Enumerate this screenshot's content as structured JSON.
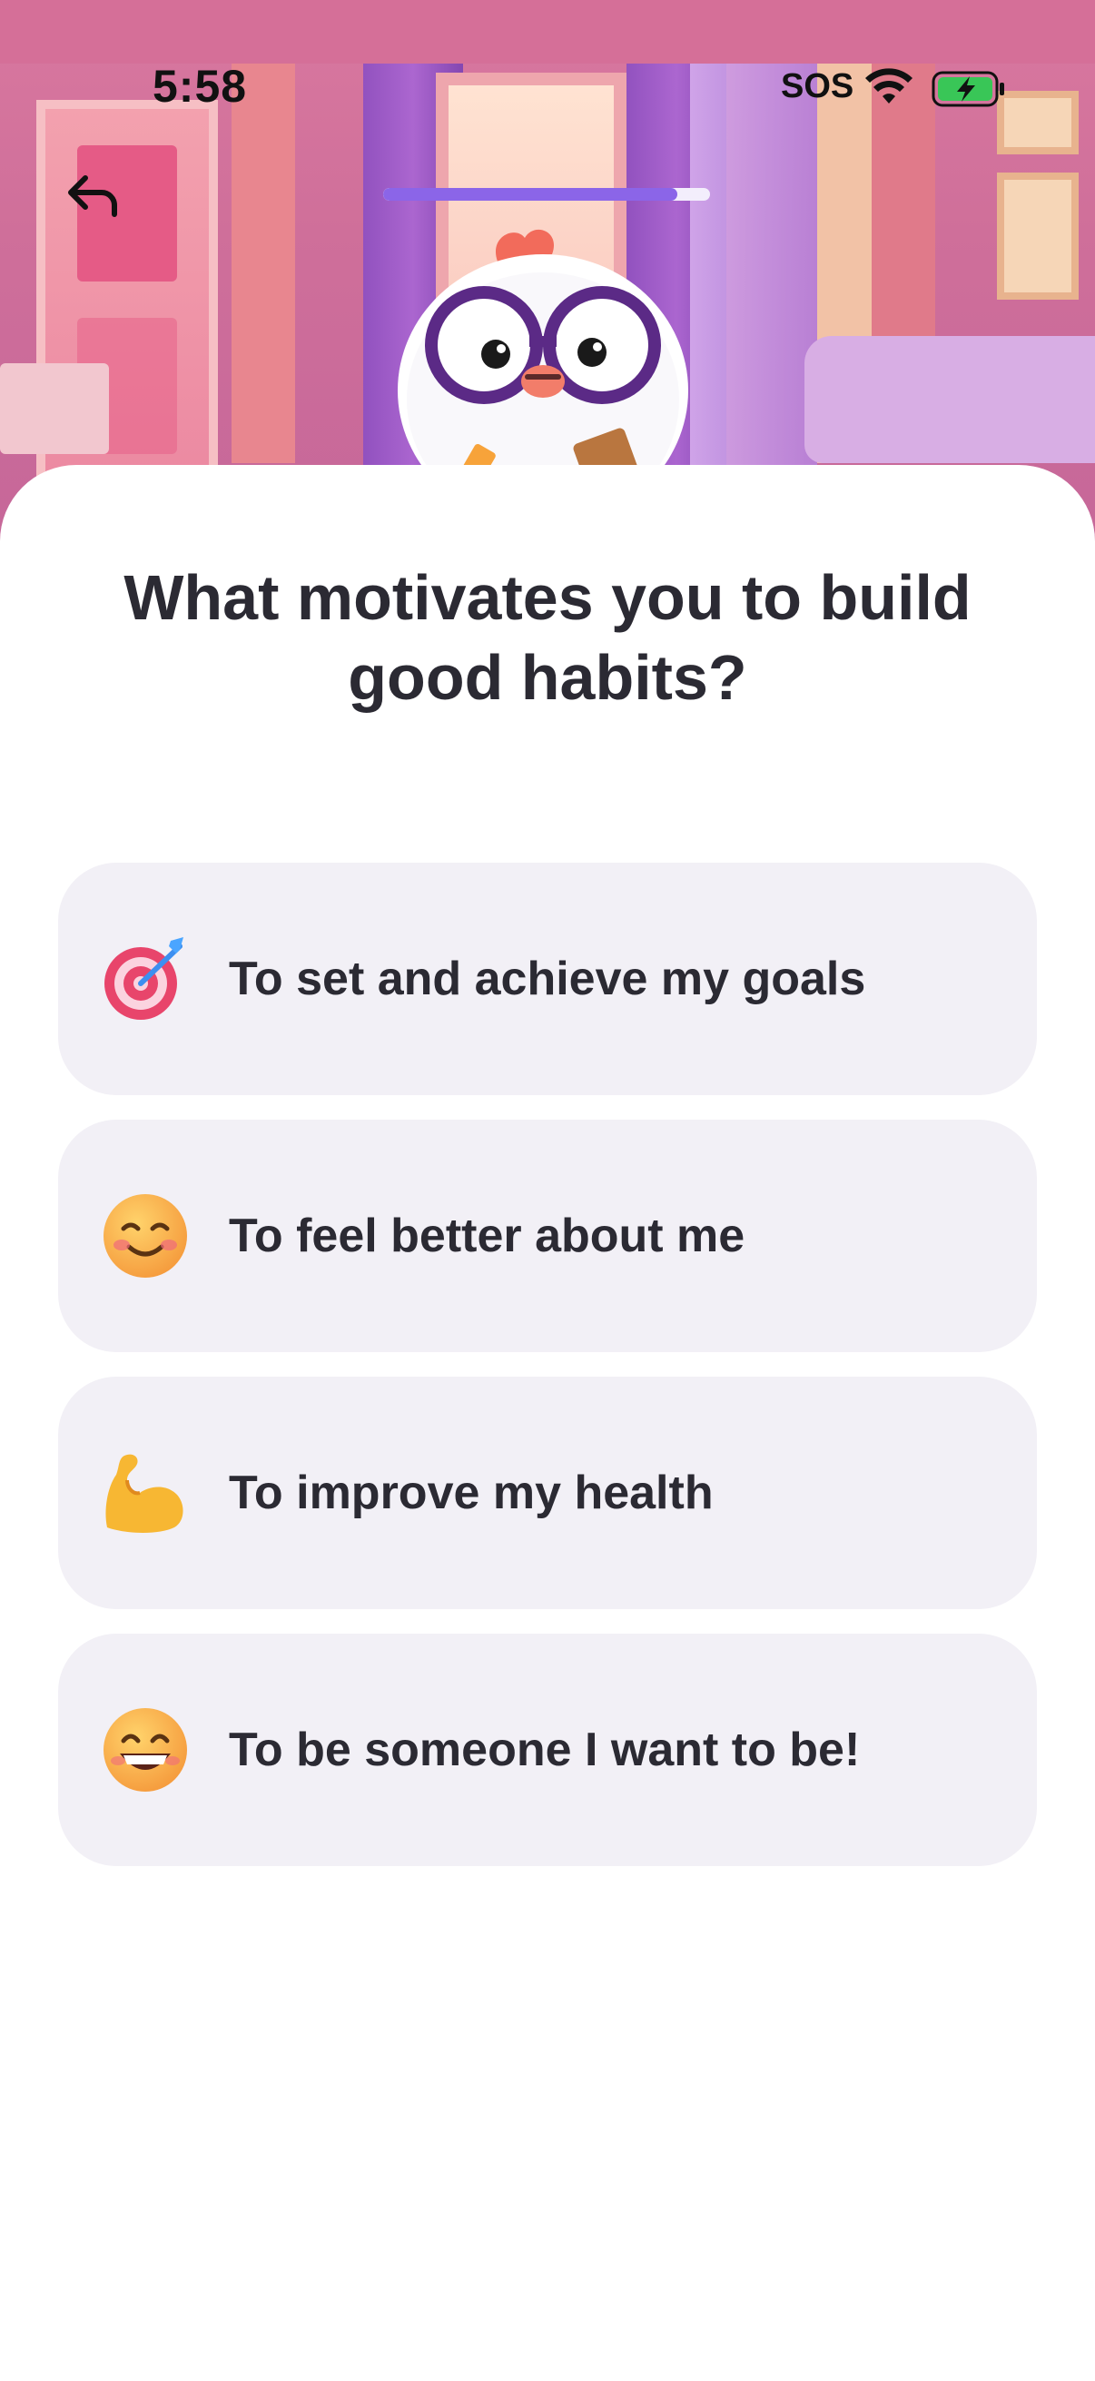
{
  "status_bar": {
    "time": "5:58",
    "carrier_text": "SOS",
    "wifi_icon": "wifi-icon",
    "battery_icon": "battery-charging-icon"
  },
  "nav": {
    "back_icon": "back-arrow-icon",
    "progress_fraction": 0.9
  },
  "mascot": {
    "icon": "chicken-with-glasses-mascot"
  },
  "question": {
    "text": "What motivates you to build good habits?"
  },
  "options": [
    {
      "icon": "target-dart-emoji",
      "label": "To set and achieve my goals"
    },
    {
      "icon": "smiling-face-emoji",
      "label": "To feel better about me"
    },
    {
      "icon": "flexed-biceps-emoji",
      "label": "To improve my health"
    },
    {
      "icon": "grinning-face-emoji",
      "label": "To be someone I want to be!"
    }
  ],
  "colors": {
    "accent": "#8b65e8",
    "option_background": "#f2f0f6",
    "text_primary": "#2b2a33",
    "scene_background": "#cf6f9a"
  }
}
